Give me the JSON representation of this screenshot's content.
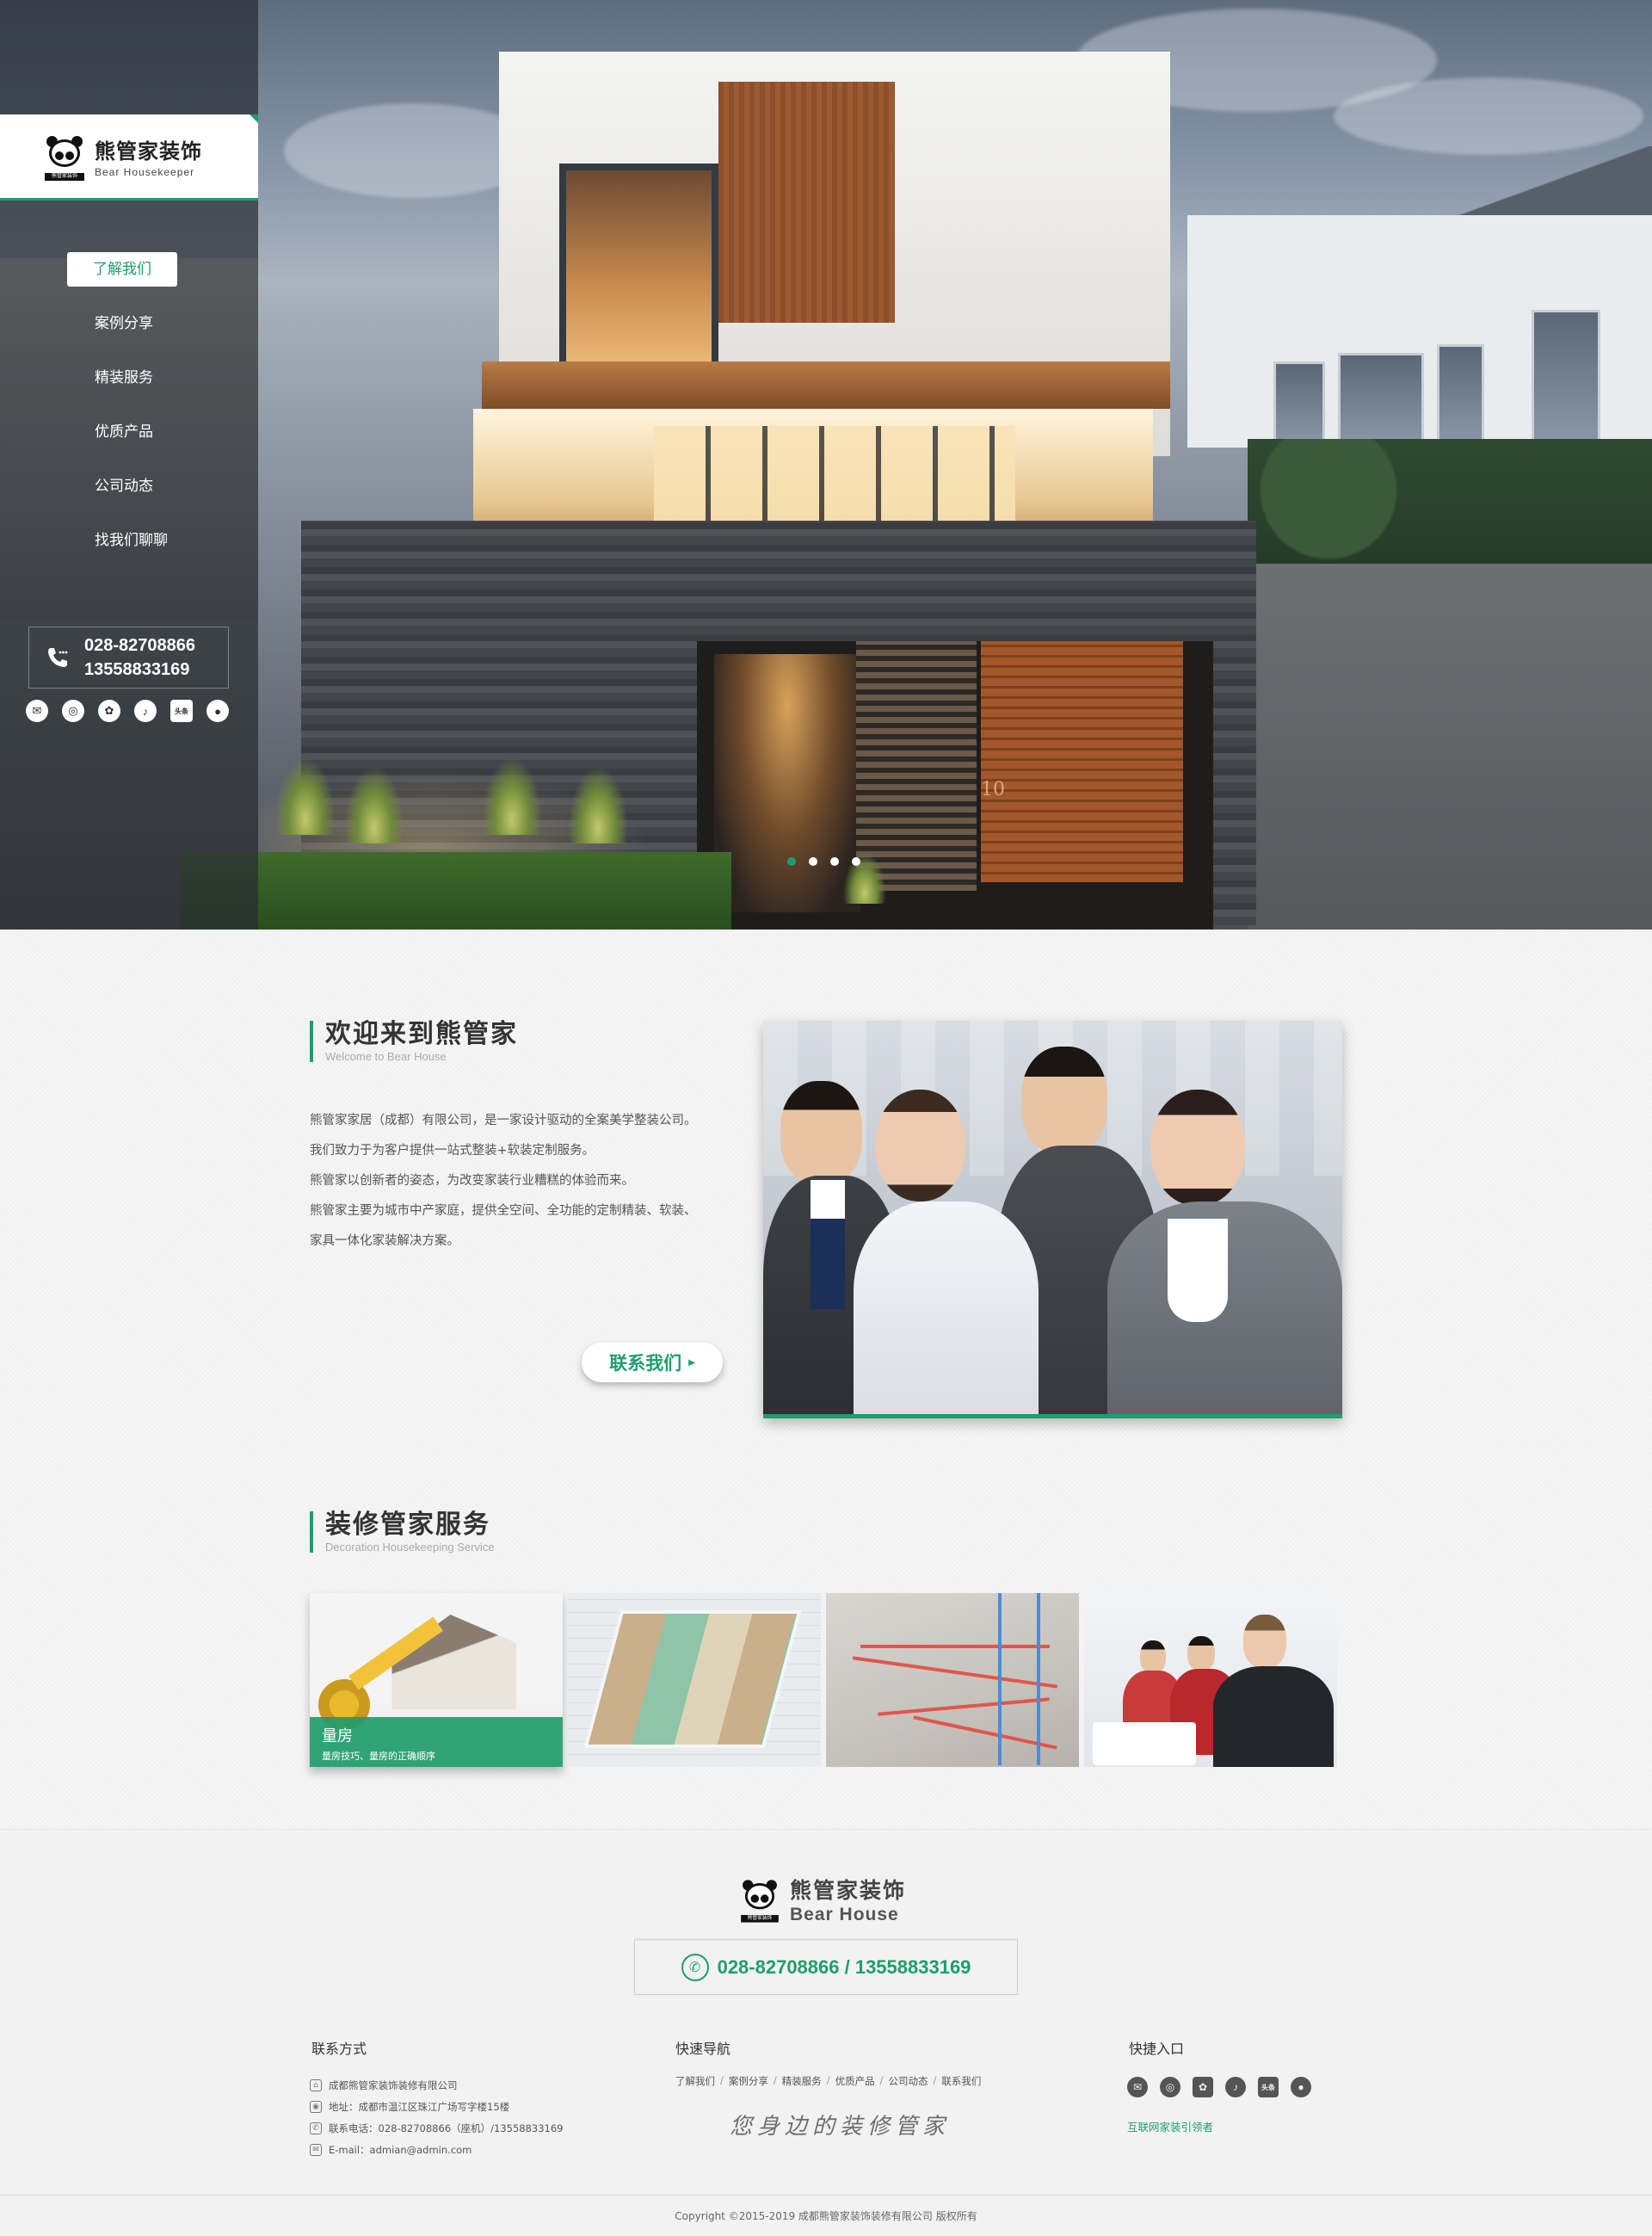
{
  "brand": {
    "name_cn": "熊管家装饰",
    "name_en": "Bear Housekeeper",
    "panda_tag": "熊管家装饰",
    "accent_color": "#1f9d6d"
  },
  "nav": {
    "items": [
      {
        "label": "了解我们",
        "active": true
      },
      {
        "label": "案例分享",
        "active": false
      },
      {
        "label": "精装服务",
        "active": false
      },
      {
        "label": "优质产品",
        "active": false
      },
      {
        "label": "公司动态",
        "active": false
      },
      {
        "label": "找我们聊聊",
        "active": false
      }
    ]
  },
  "sidebar": {
    "phone1": "028-82708866",
    "phone2": "13558833169",
    "social_icons": [
      "wechat-icon",
      "weibo-icon",
      "app-icon",
      "tiktok-icon",
      "toutiao-icon",
      "panda-app-icon"
    ],
    "toutiao_text": "头条"
  },
  "hero": {
    "house_number": "10",
    "slides_total": 4,
    "slide_active": 1
  },
  "welcome": {
    "title": "欢迎来到熊管家",
    "subtitle": "Welcome to Bear House",
    "paragraphs": [
      "熊管家家居（成都）有限公司，是一家设计驱动的全案美学整装公司。",
      "我们致力于为客户提供一站式整装+软装定制服务。",
      "熊管家以创新者的姿态，为改变家装行业糟糕的体验而来。",
      "熊管家主要为城市中产家庭，提供全空间、全功能的定制精装、软装、",
      "家具一体化家装解决方案。"
    ],
    "button": "联系我们"
  },
  "services": {
    "title": "装修管家服务",
    "subtitle": "Decoration Housekeeping Service",
    "items": [
      {
        "title": "量房",
        "desc": "量房技巧、量房的正确顺序"
      },
      {
        "title": "",
        "desc": ""
      },
      {
        "title": "",
        "desc": ""
      },
      {
        "title": "",
        "desc": ""
      }
    ]
  },
  "footer": {
    "logo_cn": "熊管家装饰",
    "logo_en": "Bear House",
    "phone": "028-82708866 / 13558833169",
    "contact_title": "联系方式",
    "contact": [
      {
        "icon": "home-icon",
        "text": "成都熊管家装饰装修有限公司"
      },
      {
        "icon": "location-icon",
        "text": "地址：成都市温江区珠江广场写字楼15楼"
      },
      {
        "icon": "phone-icon",
        "text": "联系电话：028-82708866（座机）/13558833169"
      },
      {
        "icon": "mail-icon",
        "text": "E-mail：admian@admin.com"
      }
    ],
    "nav_title": "快速导航",
    "nav_links": [
      "了解我们",
      "案例分享",
      "精装服务",
      "优质产品",
      "公司动态",
      "联系我们"
    ],
    "slogan": "您身边的装修管家",
    "quick_title": "快捷入口",
    "quick_link": "互联网家装引领者",
    "copyright": "Copyright ©2015-2019   成都熊管家装饰装修有限公司 版权所有"
  }
}
